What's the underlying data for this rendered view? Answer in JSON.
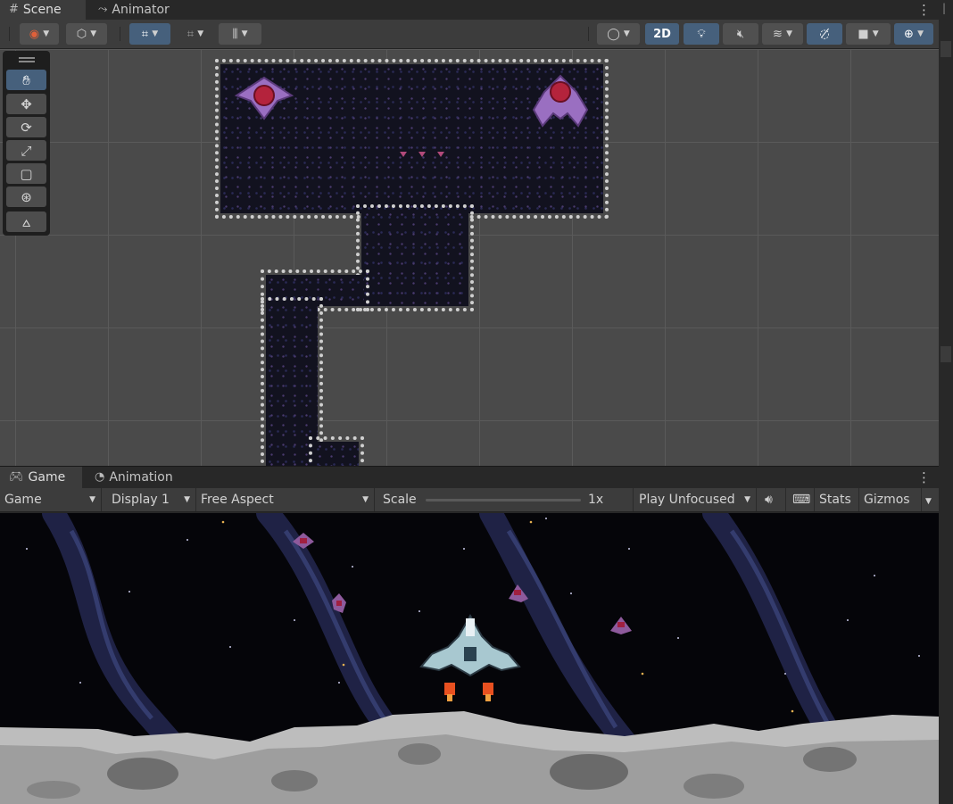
{
  "scene_tabs": [
    {
      "label": "Scene",
      "icon": "grid-icon"
    },
    {
      "label": "Animator",
      "icon": "animator-icon"
    }
  ],
  "scene_toolbar": {
    "mode_2d_label": "2D",
    "accent": "#46607c"
  },
  "tools": [
    "hand-tool",
    "move-tool",
    "rotate-tool",
    "scale-tool",
    "rect-tool",
    "transform-tool",
    "custom-tool"
  ],
  "game_tabs": [
    {
      "label": "Game",
      "icon": "gamepad-icon"
    },
    {
      "label": "Animation",
      "icon": "clock-icon"
    }
  ],
  "game_toolbar": {
    "view": "Game",
    "display": "Display 1",
    "aspect": "Free Aspect",
    "scale_label": "Scale",
    "scale_value": "1x",
    "play_mode": "Play Unfocused",
    "stats": "Stats",
    "gizmos": "Gizmos"
  }
}
